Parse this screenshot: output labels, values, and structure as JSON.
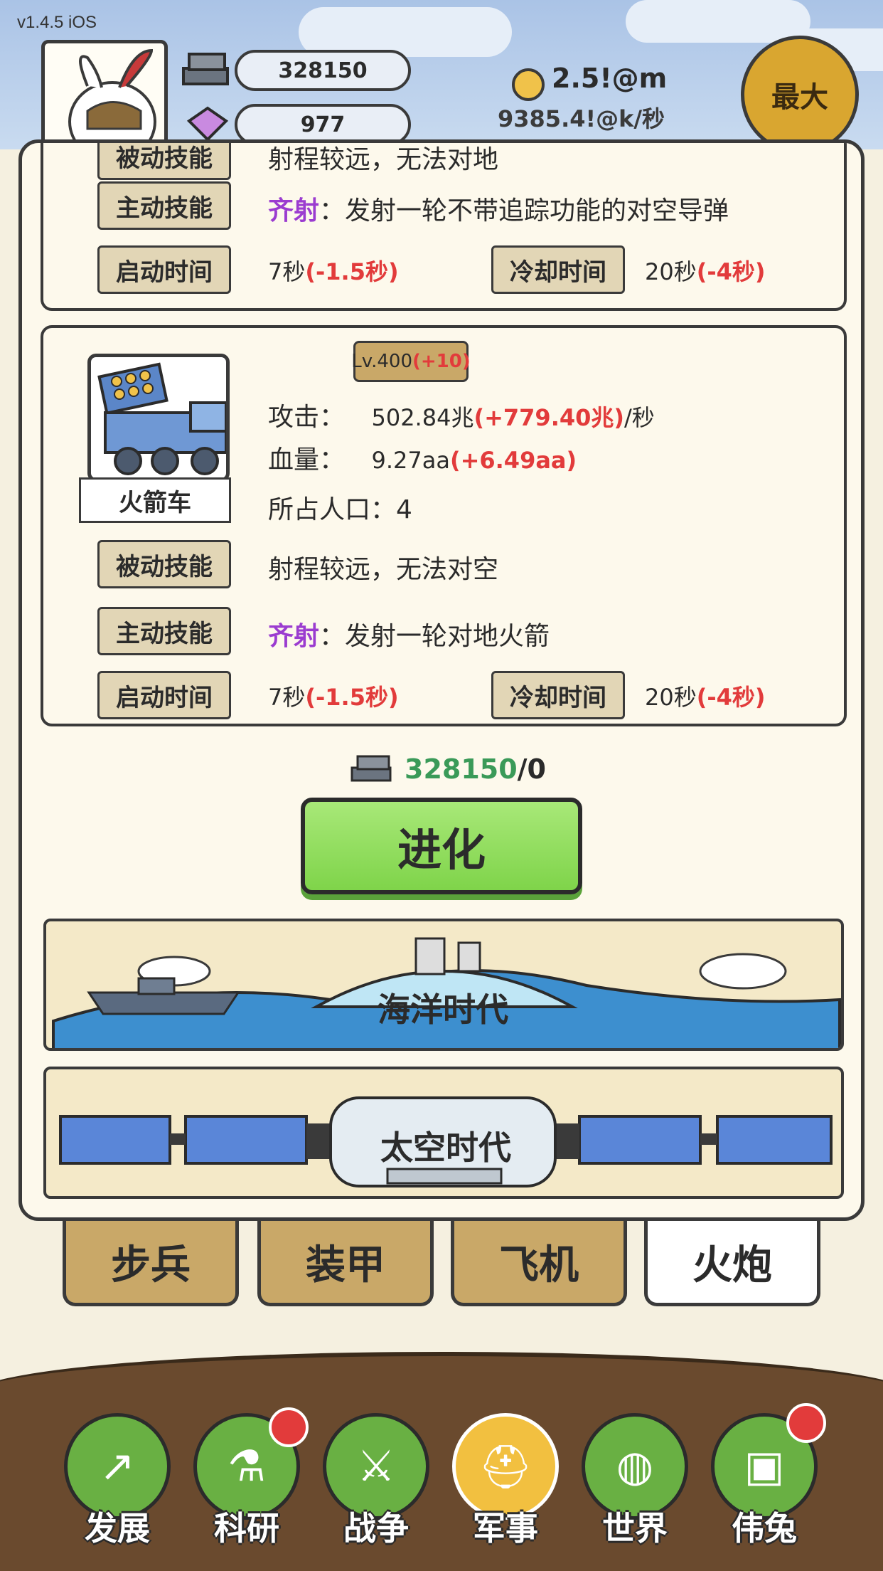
{
  "hud": {
    "version": "v1.4.5 iOS",
    "iron_amount": "328150",
    "gem_amount": "977",
    "coin_total": "2.5!@m",
    "coin_rate": "9385.4!@k/秒",
    "max_button": "最大"
  },
  "top_card": {
    "passive_partial": "被动技能",
    "passive_partial_text": "射程较远，无法对地",
    "active_tag": "主动技能",
    "active_skill_name": "齐射",
    "active_skill_desc": "：发射一轮不带追踪功能的对空导弹",
    "start_tag": "启动时间",
    "start_value": "7秒",
    "start_bonus": "(-1.5秒)",
    "cooldown_tag": "冷却时间",
    "cooldown_value": "20秒",
    "cooldown_bonus": "(-4秒)"
  },
  "unit_card": {
    "unit_name": "火箭车",
    "level": "Lv.400",
    "level_bonus": "(+10)",
    "attack_label": "攻击：",
    "attack_value": "502.84兆",
    "attack_bonus": "(+779.40兆)",
    "attack_unit": "/秒",
    "hp_label": "血量：",
    "hp_value": "9.27aa",
    "hp_bonus": "(+6.49aa)",
    "population": "所占人口：4",
    "passive_tag": "被动技能",
    "passive_text": "射程较远，无法对空",
    "active_tag": "主动技能",
    "active_skill_name": "齐射",
    "active_skill_desc": "：发射一轮对地火箭",
    "start_tag": "启动时间",
    "start_value": "7秒",
    "start_bonus": "(-1.5秒)",
    "cooldown_tag": "冷却时间",
    "cooldown_value": "20秒",
    "cooldown_bonus": "(-4秒)"
  },
  "evolve": {
    "cost_have": "328150",
    "cost_need": "/0",
    "button_label": "进化"
  },
  "eras": {
    "ocean": "海洋时代",
    "space": "太空时代"
  },
  "categories": [
    "步兵",
    "装甲",
    "飞机",
    "火炮"
  ],
  "nav": [
    "发展",
    "科研",
    "战争",
    "军事",
    "世界",
    "伟兔"
  ],
  "colors": {
    "skill_name": "#9b3cd0",
    "bonus": "#e23b3b",
    "evolve_green": "#7fd44a",
    "nav_green": "#69b043",
    "nav_active": "#f2c040"
  }
}
